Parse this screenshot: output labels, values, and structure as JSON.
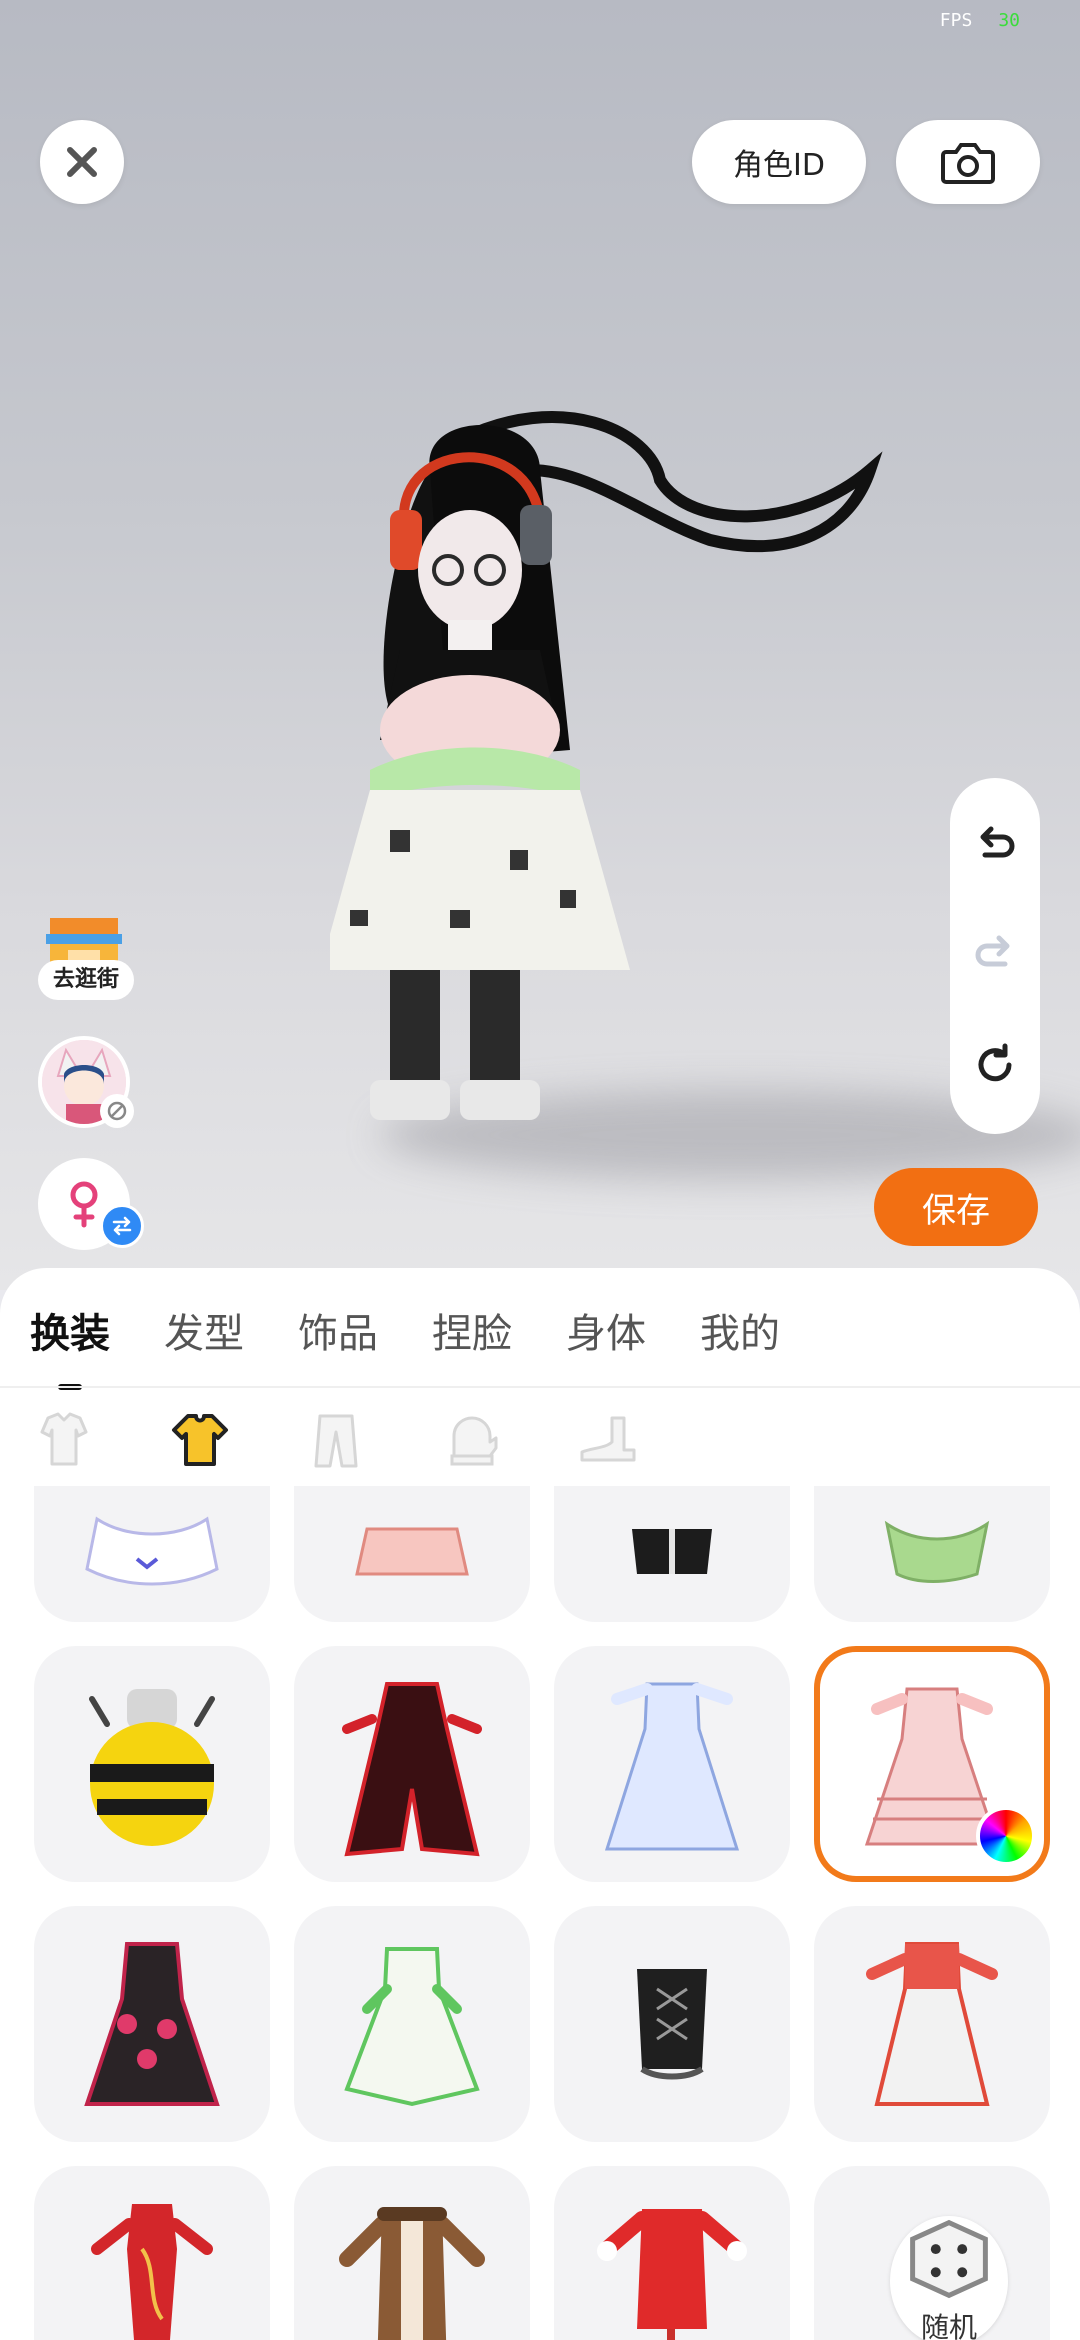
{
  "status": {
    "fps_label": "FPS",
    "fps_value": "30"
  },
  "topbar": {
    "role_id_label": "角色ID"
  },
  "left_actions": {
    "shop_label": "去逛街"
  },
  "save_label": "保存",
  "tabs": [
    {
      "label": "换装",
      "active": true
    },
    {
      "label": "发型",
      "active": false
    },
    {
      "label": "饰品",
      "active": false
    },
    {
      "label": "捏脸",
      "active": false
    },
    {
      "label": "身体",
      "active": false
    },
    {
      "label": "我的",
      "active": false
    }
  ],
  "subcategories": [
    {
      "icon": "full-outfit-icon",
      "active": false
    },
    {
      "icon": "top-shirt-icon",
      "active": true
    },
    {
      "icon": "pants-icon",
      "active": false
    },
    {
      "icon": "gloves-icon",
      "active": false
    },
    {
      "icon": "shoes-icon",
      "active": false
    }
  ],
  "outfits": [
    {
      "icon": "white-lace-dress-icon",
      "selected": false
    },
    {
      "icon": "pink-frill-dress-icon",
      "selected": false
    },
    {
      "icon": "black-hoodie-icon",
      "selected": false
    },
    {
      "icon": "green-dress-icon",
      "selected": false
    },
    {
      "icon": "bee-costume-icon",
      "selected": false
    },
    {
      "icon": "red-black-coat-icon",
      "selected": false
    },
    {
      "icon": "blue-gown-icon",
      "selected": false
    },
    {
      "icon": "pink-lolita-dress-icon",
      "selected": true
    },
    {
      "icon": "black-red-gothic-dress-icon",
      "selected": false
    },
    {
      "icon": "green-fairy-dress-icon",
      "selected": false
    },
    {
      "icon": "black-corset-icon",
      "selected": false
    },
    {
      "icon": "red-white-dress-icon",
      "selected": false
    },
    {
      "icon": "red-qipao-icon",
      "selected": false
    },
    {
      "icon": "brown-fur-coat-icon",
      "selected": false
    },
    {
      "icon": "red-qipao-bunny-icon",
      "selected": false
    },
    {
      "icon": "random-outfit-icon",
      "selected": false
    }
  ],
  "random_label": "随机",
  "colors": {
    "accent": "#f26f12",
    "swap_blue": "#2f8af5",
    "fps_green": "#3bdc3b"
  }
}
